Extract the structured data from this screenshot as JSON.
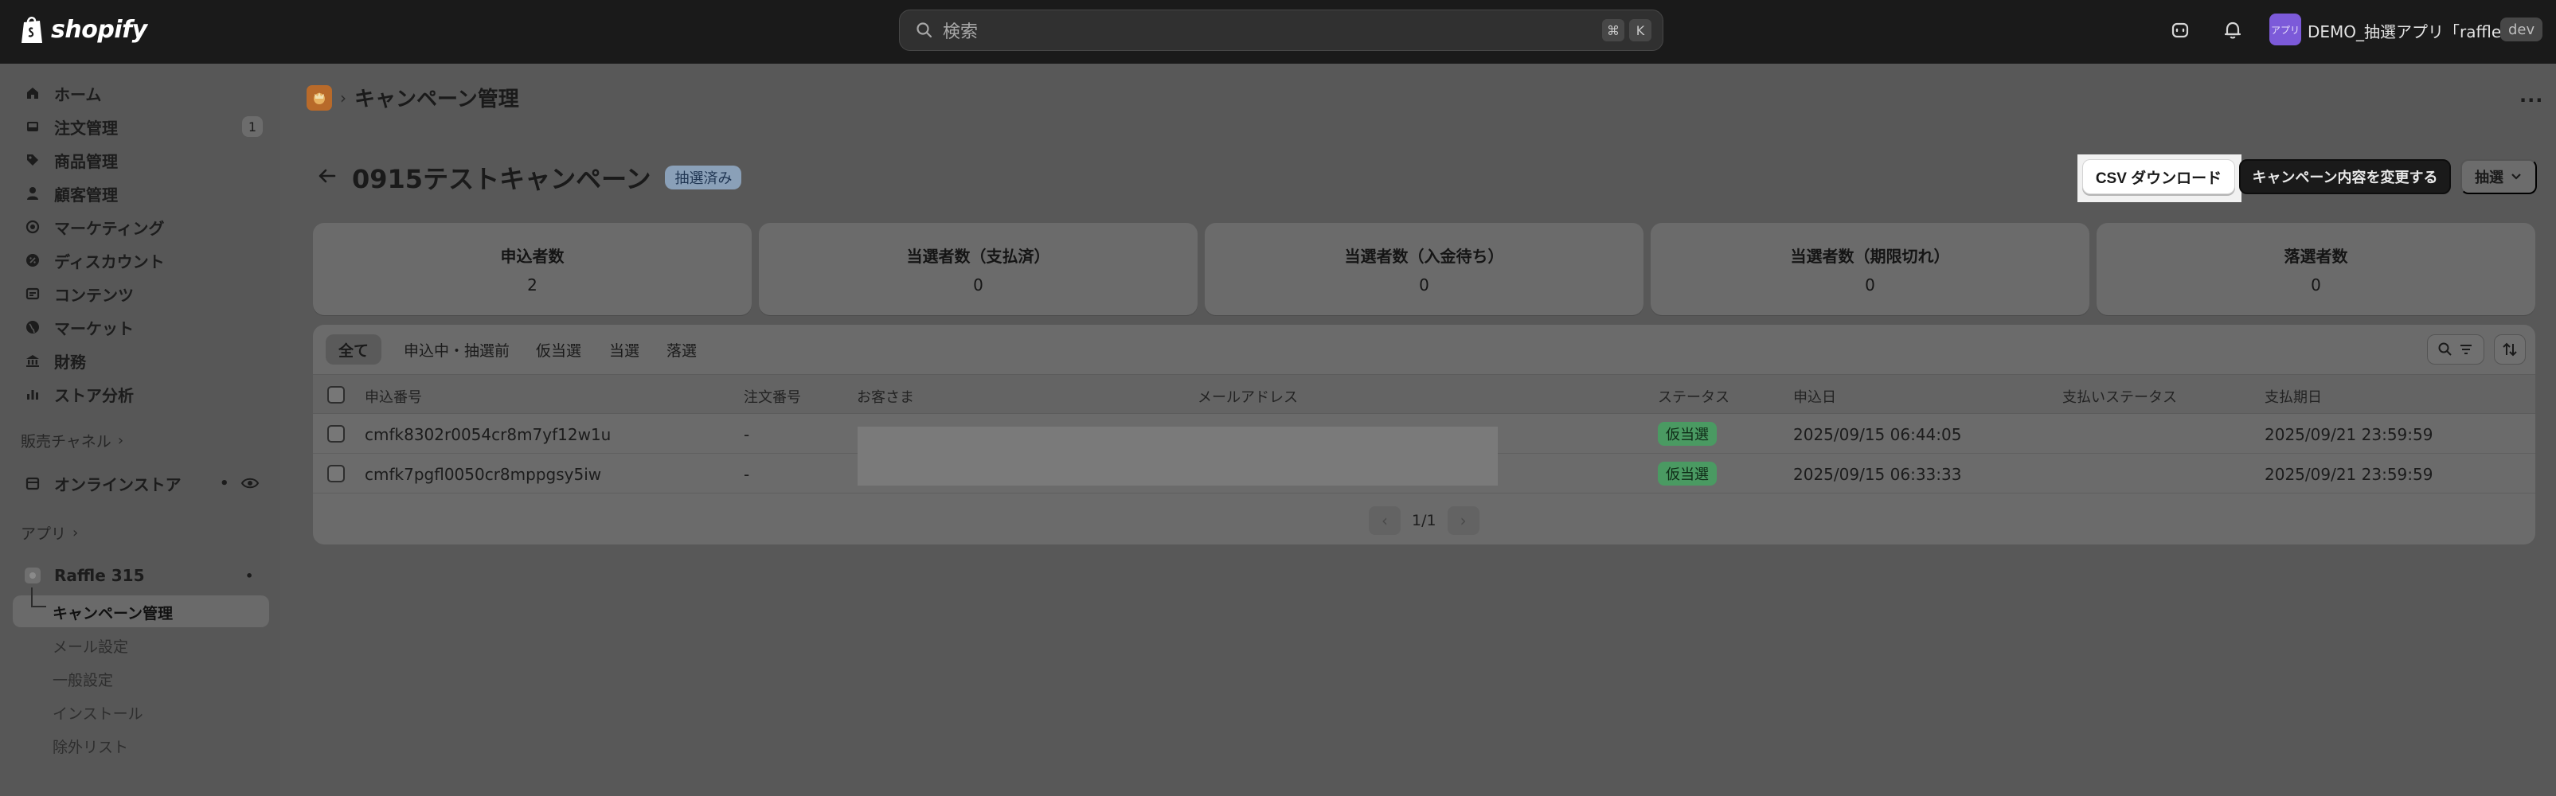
{
  "topbar": {
    "logo_text": "shopify",
    "search_placeholder": "検索",
    "shortcut_keys": [
      "⌘",
      "K"
    ],
    "avatar_text": "アプリ",
    "store_name": "DEMO_抽選アプリ「raffle...",
    "env_badge": "dev"
  },
  "sidebar": {
    "items": [
      {
        "label": "ホーム",
        "icon": "home-icon"
      },
      {
        "label": "注文管理",
        "icon": "inbox-icon",
        "badge": "1"
      },
      {
        "label": "商品管理",
        "icon": "tag-icon"
      },
      {
        "label": "顧客管理",
        "icon": "person-icon"
      },
      {
        "label": "マーケティング",
        "icon": "target-icon"
      },
      {
        "label": "ディスカウント",
        "icon": "discount-icon"
      },
      {
        "label": "コンテンツ",
        "icon": "content-icon"
      },
      {
        "label": "マーケット",
        "icon": "globe-icon"
      },
      {
        "label": "財務",
        "icon": "bank-icon"
      },
      {
        "label": "ストア分析",
        "icon": "chart-icon"
      }
    ],
    "sales_channel_label": "販売チャネル",
    "online_store_label": "オンラインストア",
    "apps_label": "アプリ",
    "app_name": "Raffle 315",
    "app_subitems": [
      "キャンペーン管理",
      "メール設定",
      "一般設定",
      "インストール",
      "除外リスト"
    ]
  },
  "page": {
    "header_title": "キャンペーン管理",
    "campaign_title": "0915テストキャンペーン",
    "status_label": "抽選済み",
    "csv_button": "CSV ダウンロード",
    "edit_button": "キャンペーン内容を変更する",
    "lottery_button": "抽選"
  },
  "stats": [
    {
      "label": "申込者数",
      "value": "2"
    },
    {
      "label": "当選者数（支払済）",
      "value": "0"
    },
    {
      "label": "当選者数（入金待ち）",
      "value": "0"
    },
    {
      "label": "当選者数（期限切れ）",
      "value": "0"
    },
    {
      "label": "落選者数",
      "value": "0"
    }
  ],
  "tabs": [
    "全て",
    "申込中・抽選前",
    "仮当選",
    "当選",
    "落選"
  ],
  "table": {
    "columns": [
      "申込番号",
      "注文番号",
      "お客さま",
      "メールアドレス",
      "ステータス",
      "申込日",
      "支払いステータス",
      "支払期日"
    ],
    "rows": [
      {
        "id": "cmfk8302r0054cr8m7yf12w1u",
        "order": "-",
        "status": "仮当選",
        "applied": "2025/09/15 06:44:05",
        "due": "2025/09/21 23:59:59"
      },
      {
        "id": "cmfk7pgfl0050cr8mppgsy5iw",
        "order": "-",
        "status": "仮当選",
        "applied": "2025/09/15 06:33:33",
        "due": "2025/09/21 23:59:59"
      }
    ]
  },
  "pagination": {
    "text": "1/1"
  }
}
